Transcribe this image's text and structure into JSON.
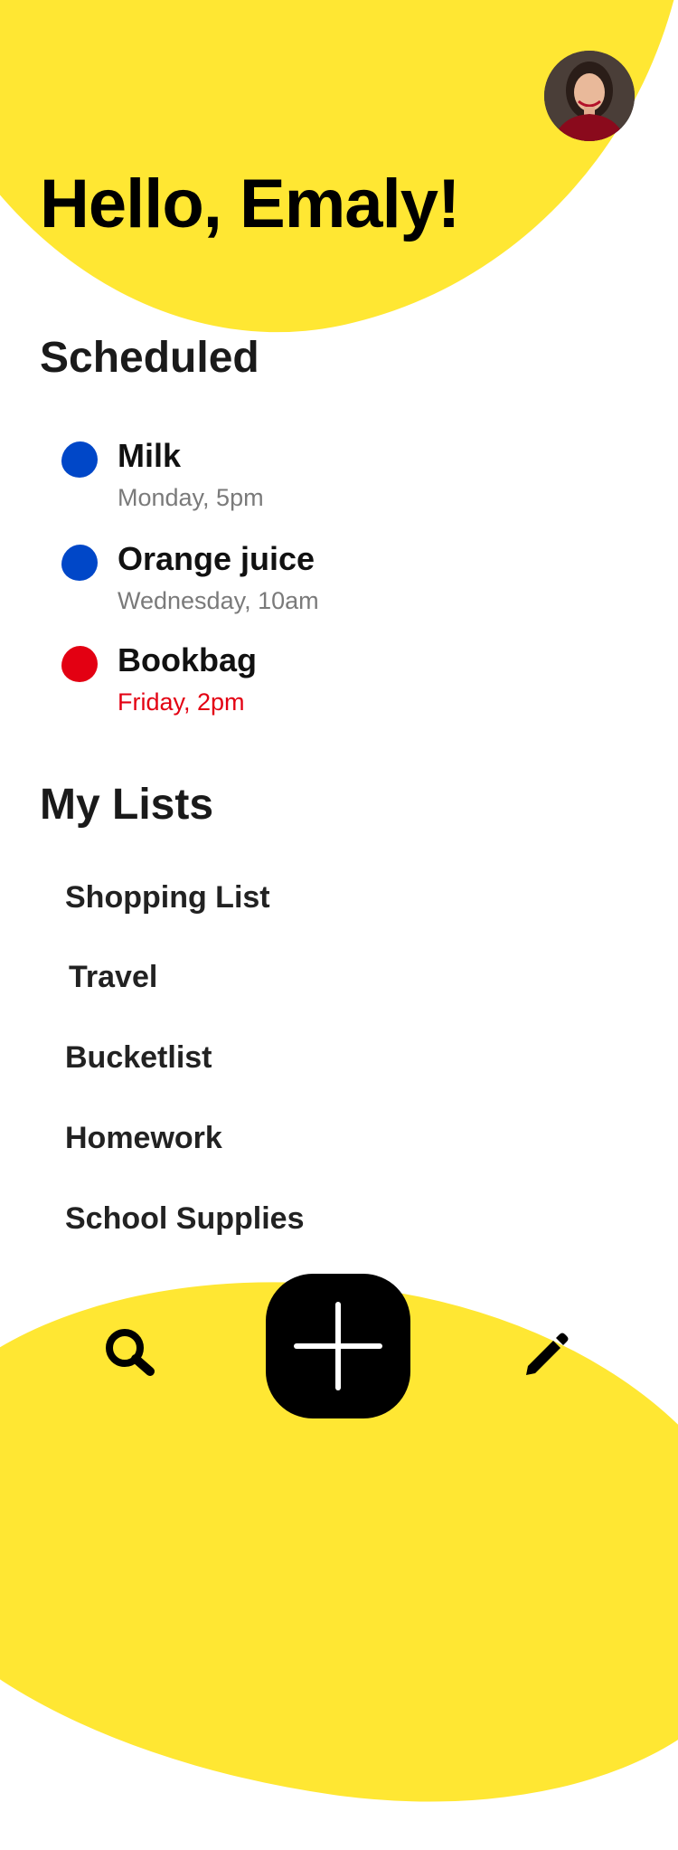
{
  "colors": {
    "accent_yellow": "#ffe733",
    "dot_blue": "#0047c8",
    "dot_red": "#e30012",
    "overdue_red": "#e30012",
    "muted_gray": "#7a7a7a"
  },
  "header": {
    "greeting": "Hello, Emaly!",
    "avatar_icon": "user-avatar"
  },
  "scheduled": {
    "title": "Scheduled",
    "items": [
      {
        "title": "Milk",
        "time": "Monday, 5pm",
        "dot_color": "#0047c8",
        "time_color": "#7a7a7a"
      },
      {
        "title": "Orange juice",
        "time": "Wednesday, 10am",
        "dot_color": "#0047c8",
        "time_color": "#7a7a7a"
      },
      {
        "title": "Bookbag",
        "time": "Friday, 2pm",
        "dot_color": "#e30012",
        "time_color": "#e30012"
      }
    ]
  },
  "my_lists": {
    "title": "My Lists",
    "items": [
      {
        "label": "Shopping List"
      },
      {
        "label": "Travel"
      },
      {
        "label": "Bucketlist"
      },
      {
        "label": "Homework"
      },
      {
        "label": "School Supplies"
      }
    ]
  },
  "nav": {
    "search_icon": "search-icon",
    "add_icon": "plus-icon",
    "edit_icon": "pencil-icon"
  }
}
